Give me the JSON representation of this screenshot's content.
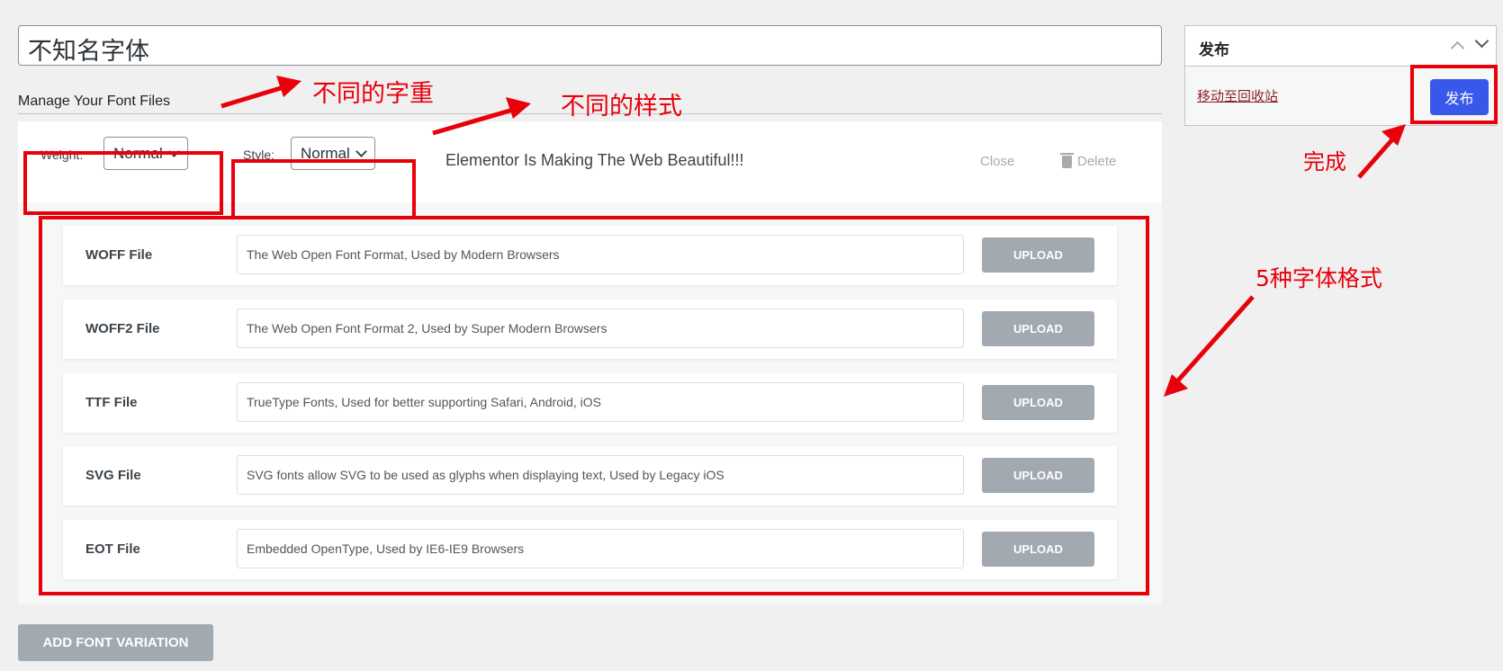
{
  "title_input": {
    "value": "不知名字体"
  },
  "section_title": "Manage Your Font Files",
  "variation": {
    "weight_label": "Weight:",
    "weight_value": "Normal",
    "style_label": "Style:",
    "style_value": "Normal",
    "preview_text": "Elementor Is Making The Web Beautiful!!!",
    "close_label": "Close",
    "delete_label": "Delete"
  },
  "files": [
    {
      "name": "WOFF File",
      "placeholder": "The Web Open Font Format, Used by Modern Browsers",
      "button": "UPLOAD"
    },
    {
      "name": "WOFF2 File",
      "placeholder": "The Web Open Font Format 2, Used by Super Modern Browsers",
      "button": "UPLOAD"
    },
    {
      "name": "TTF File",
      "placeholder": "TrueType Fonts, Used for better supporting Safari, Android, iOS",
      "button": "UPLOAD"
    },
    {
      "name": "SVG File",
      "placeholder": "SVG fonts allow SVG to be used as glyphs when displaying text, Used by Legacy iOS",
      "button": "UPLOAD"
    },
    {
      "name": "EOT File",
      "placeholder": "Embedded OpenType, Used by IE6-IE9 Browsers",
      "button": "UPLOAD"
    }
  ],
  "add_variation_label": "ADD FONT VARIATION",
  "publish_box": {
    "title": "发布",
    "trash_link": "移动至回收站",
    "publish_button": "发布"
  },
  "annotations": {
    "weight": "不同的字重",
    "style": "不同的样式",
    "done": "完成",
    "formats": "5种字体格式"
  },
  "colors": {
    "annotation": "#e8000b",
    "publish": "#3858e9",
    "upload": "#a2a9b1"
  }
}
